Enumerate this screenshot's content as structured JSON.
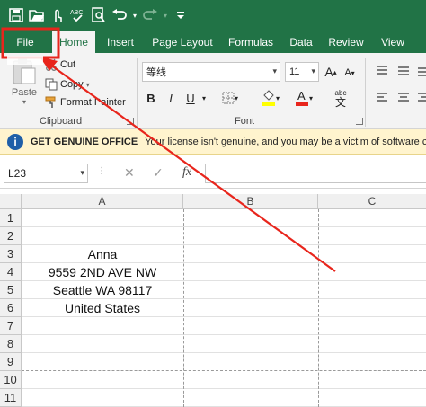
{
  "quick_access": {
    "icons": [
      "save-icon",
      "open-icon",
      "touch-mode-icon",
      "spelling-icon",
      "print-preview-icon",
      "undo-icon",
      "redo-icon",
      "customize-icon"
    ],
    "spelling_glyph": "ABC"
  },
  "ribbon_tabs": [
    "File",
    "Home",
    "Insert",
    "Page Layout",
    "Formulas",
    "Data",
    "Review",
    "View"
  ],
  "active_tab": "Home",
  "clipboard": {
    "paste_label": "Paste",
    "cut_label": "Cut",
    "copy_label": "Copy",
    "format_painter_label": "Format Painter",
    "group_label": "Clipboard"
  },
  "font": {
    "font_name": "等线",
    "font_size": "11",
    "group_label": "Font",
    "bold_glyph": "B",
    "italic_glyph": "I",
    "underline_glyph": "U",
    "grow_glyph": "A",
    "shrink_glyph": "A",
    "font_color_glyph": "A",
    "phonetic_glyph": "abc",
    "fill_color": "#ffff00",
    "font_color": "#e8251c"
  },
  "message_bar": {
    "title": "GET GENUINE OFFICE",
    "text": "Your license isn't genuine, and you may be a victim of software co",
    "icon": "info-icon"
  },
  "formula_bar": {
    "name_box": "L23",
    "cancel_glyph": "✕",
    "enter_glyph": "✓",
    "fx_glyph": "fx",
    "formula": ""
  },
  "sheet": {
    "columns": [
      "A",
      "B",
      "C"
    ],
    "rows": [
      "1",
      "2",
      "3",
      "4",
      "5",
      "6",
      "7",
      "8",
      "9",
      "10",
      "11"
    ],
    "cells_col_a": [
      "",
      "",
      "Anna",
      "9559 2ND AVE NW",
      "Seattle WA 98117",
      "United States",
      "",
      "",
      "",
      "",
      ""
    ]
  },
  "annotation": {
    "color": "#e8251c",
    "target": "File"
  }
}
